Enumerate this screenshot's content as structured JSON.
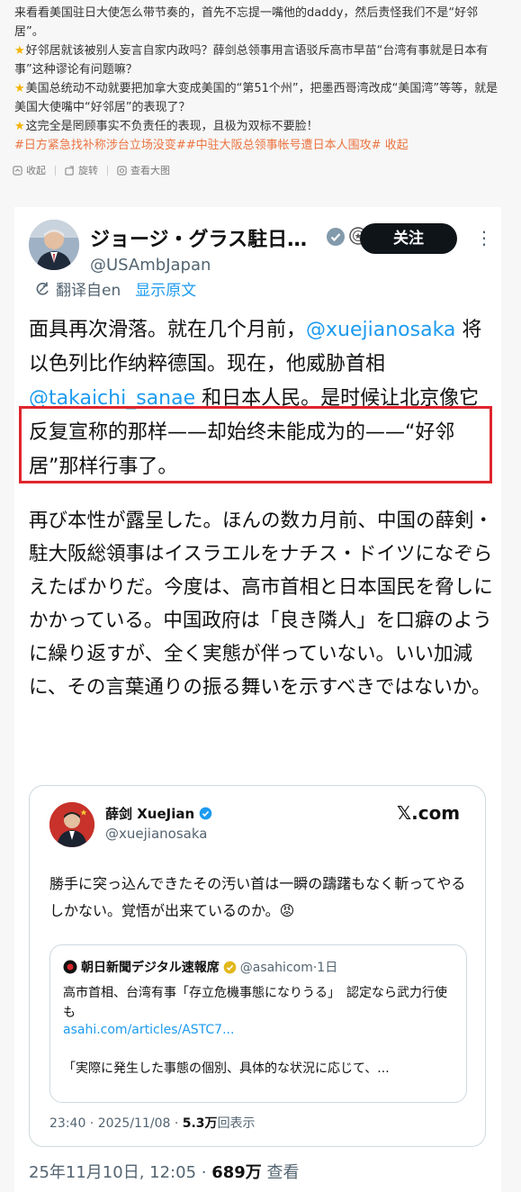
{
  "intro": {
    "line1": "来看看美国驻日大使怎么带节奏的，首先不忘提一嘴他的daddy，然后责怪我们不是“好邻居”。",
    "bullets": [
      "好邻居就该被别人妄言自家内政吗？薛剑总领事用言语驳斥高市早苗“台湾有事就是日本有事”这种谬论有问题嘛？",
      "美国总统动不动就要把加拿大变成美国的“第51个州”，把墨西哥湾改成“美国湾”等等，就是美国大使嘴中“好邻居”的表现了？",
      "这完全是罔顾事实不负责任的表现，且极为双标不要脸！"
    ],
    "tags": "#日方紧急找补称涉台立场没变##中驻大阪总领事帐号遭日本人围攻# 收起"
  },
  "actions": {
    "collapse": "收起",
    "rotate": "旋转",
    "view_large": "查看大图"
  },
  "tweet": {
    "display_name": "ジョージ・グラス駐日…",
    "handle": "@USAmbJapan",
    "follow_label": "关注",
    "translated_from": "翻译自en",
    "show_original": "显示原文",
    "zh_text": {
      "p1": "面具再次滑落。就在几个月前，",
      "m1": "@xuejianosaka",
      "p2": " 将以色列比作纳粹德国。现在，他威胁首相 ",
      "m2": "@takaichi_sanae",
      "p3": " 和日本人民。是时候让北京像它反复宣称的那样——却始终未能成为的——“好邻居”那样行事了。"
    },
    "ja_text": "再び本性が露呈した。ほんの数カ月前、中国の薛剣・駐大阪総領事はイスラエルをナチス・ドイツになぞらえたばかりだ。今度は、高市首相と日本国民を脅しにかかっている。中国政府は「良き隣人」を口癖のように繰り返すが、全く実態が伴っていない。いい加減に、その言葉通りの振る舞いを示すべきではないか。",
    "timestamp": "25年11月10日, 12:05",
    "views": "689万",
    "views_label": "查看"
  },
  "quote": {
    "name": "薛剑 XueJian",
    "handle": "@xuejianosaka",
    "source": "𝕏.com",
    "text": "勝手に突っ込んできたその汚い首は一瞬の躊躇もなく斬ってやるしかない。覚悟が出来ているのか。😡",
    "inner": {
      "name": "朝日新聞デジタル速報席",
      "handle": "@asahicom·1日",
      "body": "高市首相、台湾有事「存立危機事態になりうる」　認定なら武力行使も",
      "link": "asahi.com/articles/ASTC7...",
      "excerpt": "「実際に発生した事態の個別、具体的な状況に応じて、..."
    },
    "meta_time": "23:40 · 2025/11/08 · ",
    "meta_views": "5.3万",
    "meta_views_label": "回表示"
  },
  "colors": {
    "link": "#1d9bf0",
    "highlight_box": "#e0252d",
    "tag": "#eb7340",
    "star": "#f5b301"
  }
}
